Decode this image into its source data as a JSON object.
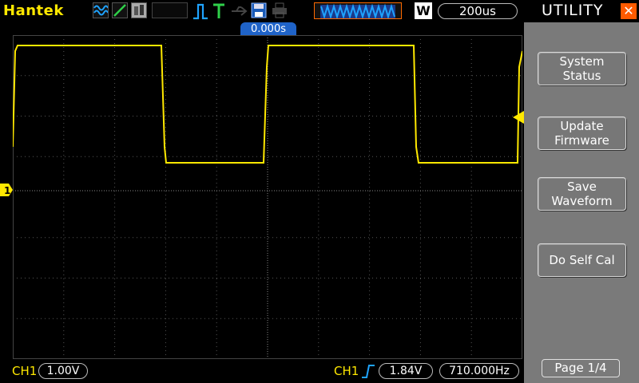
{
  "brand": "Hantek",
  "toolbar": {
    "trigger_position": "0.000s",
    "timebase_mode": "W",
    "timebase": "200us"
  },
  "panel": {
    "title": "UTILITY",
    "close_icon": "close-icon",
    "buttons": [
      {
        "line1": "System",
        "line2": "Status"
      },
      {
        "line1": "Update",
        "line2": "Firmware"
      },
      {
        "line1": "Save",
        "line2": "Waveform"
      },
      {
        "line1": "Do Self Cal",
        "line2": ""
      }
    ],
    "page": "Page 1/4"
  },
  "status": {
    "ch1_label": "CH1",
    "ch1_scale": "1.00V",
    "trig_source": "CH1",
    "trig_level": "1.84V",
    "frequency": "710.000Hz"
  },
  "colors": {
    "trace": "#ffe800",
    "accent": "#1fa3ff",
    "panel_bg": "#7a7a7a",
    "close_bg": "#ff5a00"
  },
  "channel_marker": "1"
}
